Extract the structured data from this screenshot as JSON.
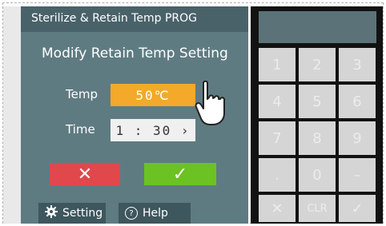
{
  "window_title": "Sterilize & Retain Temp PROG",
  "heading": "Modify Retain Temp Setting",
  "temp": {
    "label": "Temp",
    "value": "50℃"
  },
  "time": {
    "label": "Time",
    "value": "1 : 30 ›"
  },
  "buttons": {
    "cancel": "✕",
    "confirm": "✓"
  },
  "footer": {
    "setting": "Setting",
    "help": "Help"
  },
  "keypad": [
    "1",
    "2",
    "3",
    "4",
    "5",
    "6",
    "7",
    "8",
    "9",
    ".",
    "0",
    "–",
    "✕",
    "CLR",
    "✓"
  ],
  "colors": {
    "panel": "#5f7b82",
    "temp_field": "#f4a92a",
    "cancel": "#e0484b",
    "confirm": "#6cc223"
  }
}
